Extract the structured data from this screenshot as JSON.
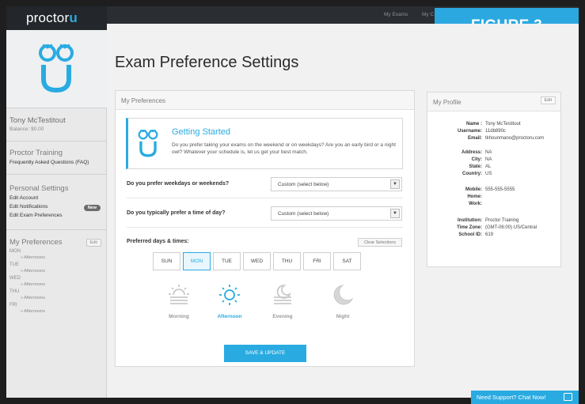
{
  "brand": {
    "text": "proctor",
    "u": "u"
  },
  "top_nav": {
    "my_exams": "My Exams",
    "my_other": "My C"
  },
  "figure_label": "FIGURE 3",
  "sidebar": {
    "user_name": "Tony McTestitout",
    "balance": "Balance: $0.00",
    "training_title": "Proctor Training",
    "faq": "Frequently Asked Questions (FAQ)",
    "personal_title": "Personal Settings",
    "edit_account": "Edit Account",
    "edit_notifications": "Edit Notifications",
    "new_badge": "New",
    "edit_exam_prefs": "Edit Exam Preferences",
    "prefs_title": "My Preferences",
    "prefs_edit": "Edit",
    "prefs": [
      {
        "day": "MON",
        "slot": "» Afternoons"
      },
      {
        "day": "TUE",
        "slot": "» Afternoons"
      },
      {
        "day": "WED",
        "slot": "» Afternoons"
      },
      {
        "day": "THU",
        "slot": "» Afternoons"
      },
      {
        "day": "FRI",
        "slot": "» Afternoons"
      }
    ]
  },
  "page_title": "Exam Preference Settings",
  "preferences": {
    "card_title": "My Preferences",
    "getting_started_title": "Getting Started",
    "getting_started_text": "Do you prefer taking your exams on the weekend or on weekdays? Are you an early bird or a night owl? Whatever your schedule is, let us get your best match.",
    "q1": "Do you prefer weekdays or weekends?",
    "q1_value": "Custom (select below)",
    "q2": "Do you typically prefer a time of day?",
    "q2_value": "Custom (select below)",
    "days_label": "Preferred days & times:",
    "clear": "Clear Selections",
    "days": [
      "SUN",
      "MON",
      "TUE",
      "WED",
      "THU",
      "FRI",
      "SAT"
    ],
    "selected_day": "MON",
    "times": [
      "Morning",
      "Afternoon",
      "Evening",
      "Night"
    ],
    "selected_time": "Afternoon",
    "save": "SAVE & UPDATE"
  },
  "profile": {
    "card_title": "My Profile",
    "edit": "Edit",
    "name_label": "Name :",
    "name": "Tony McTestitout",
    "username_label": "Username:",
    "username": "11db890c",
    "email_label": "Email:",
    "email": "tkhounmano@proctoru.com",
    "address_label": "Address:",
    "address": "NA",
    "city_label": "City:",
    "city": "NA",
    "state_label": "State:",
    "state": "AL",
    "country_label": "Country:",
    "country": "US",
    "mobile_label": "Mobile:",
    "mobile": "555-555-5555",
    "home_label": "Home:",
    "home": "",
    "work_label": "Work:",
    "work": "",
    "institution_label": "Institution:",
    "institution": "Proctor Training",
    "timezone_label": "Time Zone:",
    "timezone": "(GMT-06:00) US/Central",
    "school_label": "School ID:",
    "school": "619"
  },
  "chat": "Need Support? Chat Now!",
  "colors": {
    "accent": "#29abe2",
    "sidebar": "#e9e9ea",
    "topbar": "#2a2d31"
  },
  "icons": {
    "morning": "sunrise-icon",
    "afternoon": "sun-icon",
    "evening": "sunset-icon",
    "night": "moon-icon"
  }
}
